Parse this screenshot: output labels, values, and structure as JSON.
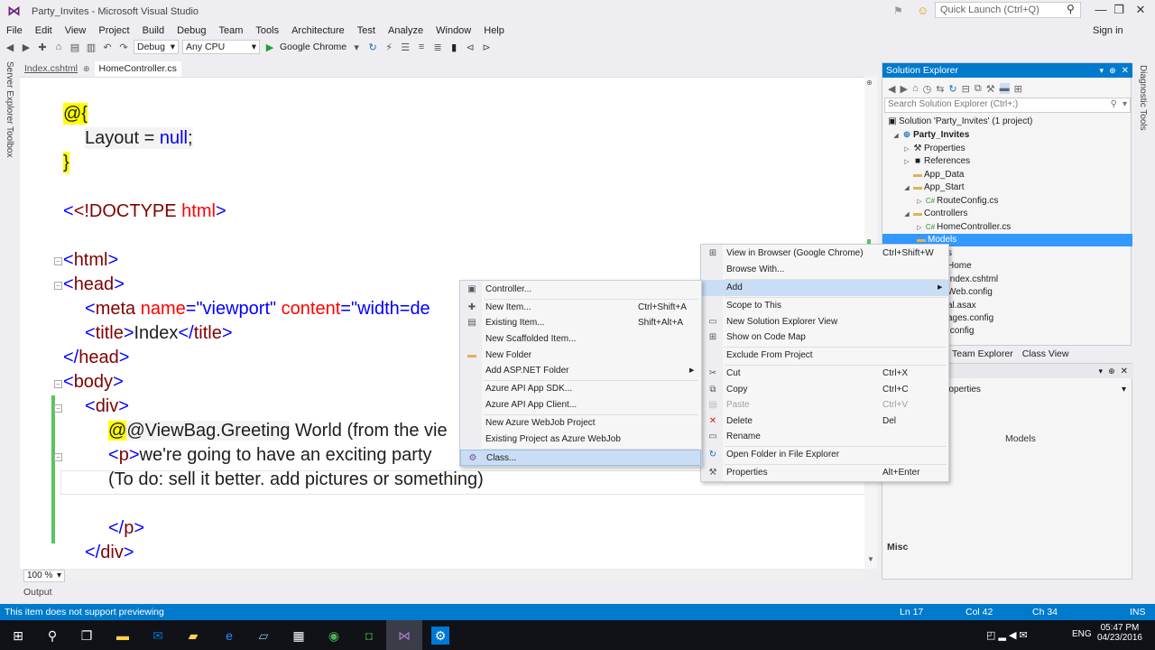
{
  "window": {
    "title": "Party_Invites - Microsoft Visual Studio",
    "quick_launch_placeholder": "Quick Launch (Ctrl+Q)",
    "sign_in": "Sign in"
  },
  "menu": [
    "File",
    "Edit",
    "View",
    "Project",
    "Build",
    "Debug",
    "Team",
    "Tools",
    "Architecture",
    "Test",
    "Analyze",
    "Window",
    "Help"
  ],
  "toolbar": {
    "config": "Debug",
    "platform": "Any CPU",
    "browser": "Google Chrome"
  },
  "left_tabs": [
    "Server Explorer",
    "Toolbox"
  ],
  "doc_tabs": [
    {
      "label": "Index.cshtml",
      "active": false
    },
    {
      "label": "HomeController.cs",
      "active": true
    }
  ],
  "editor": {
    "zoom": "100 %",
    "lines": {
      "l1": "@{",
      "l2a": "Layout = ",
      "l2b": "null",
      "l2c": ";",
      "l3": "}",
      "l4a": "<!DOCTYPE",
      "l4b": "html",
      "l4c": ">",
      "l5": "html",
      "l6": "head",
      "l7a": "meta",
      "l7b": "name",
      "l7c": "\"viewport\"",
      "l7d": "content",
      "l7e": "\"width=de",
      "l8a": "title",
      "l8b": "Index",
      "l9": "head",
      "l10": "body",
      "l11": "div",
      "l12a": "@ViewBag.Greeting",
      "l12b": " World (from the vie",
      "l13a": "p",
      "l13b": "we're going to have an exciting party",
      "l14": "(To do: sell it better. add pictures or something)",
      "l15": "p",
      "l16": "div"
    }
  },
  "output_tab": "Output",
  "status": {
    "message": "This item does not support previewing",
    "ln": "Ln 17",
    "col": "Col 42",
    "ch": "Ch 34",
    "mode": "INS"
  },
  "solution_explorer": {
    "title": "Solution Explorer",
    "search_placeholder": "Search Solution Explorer (Ctrl+;)",
    "items": [
      {
        "label": "Solution 'Party_Invites' (1 project)",
        "indent": 0
      },
      {
        "label": "Party_Invites",
        "indent": 1,
        "bold": true
      },
      {
        "label": "Properties",
        "indent": 2
      },
      {
        "label": "References",
        "indent": 2
      },
      {
        "label": "App_Data",
        "indent": 2
      },
      {
        "label": "App_Start",
        "indent": 2
      },
      {
        "label": "RouteConfig.cs",
        "indent": 3
      },
      {
        "label": "Controllers",
        "indent": 2
      },
      {
        "label": "HomeController.cs",
        "indent": 3
      },
      {
        "label": "Models",
        "indent": 2,
        "selected": true
      },
      {
        "label": "s",
        "indent": 2
      },
      {
        "label": "Home",
        "indent": 2
      },
      {
        "label": "Index.cshtml",
        "indent": 3
      },
      {
        "label": "Web.config",
        "indent": 2
      },
      {
        "label": "al.asax",
        "indent": 2
      },
      {
        "label": "ages.config",
        "indent": 2
      },
      {
        "label": ".config",
        "indent": 2
      }
    ],
    "bottom_tabs": [
      "Team Explorer",
      "Class View"
    ]
  },
  "properties": {
    "combo": "roperties",
    "object": "Models",
    "category": "Misc"
  },
  "diagnostic_tab": "Diagnostic Tools",
  "context_menu_main": [
    {
      "label": "View in Browser (Google Chrome)",
      "shortcut": "Ctrl+Shift+W",
      "icon": "browser-icon"
    },
    {
      "label": "Browse With...",
      "shortcut": "",
      "icon": ""
    },
    {
      "label": "Add",
      "shortcut": "",
      "icon": "",
      "submenu": true,
      "highlighted": true
    },
    {
      "label": "Scope to This",
      "shortcut": "",
      "icon": ""
    },
    {
      "label": "New Solution Explorer View",
      "shortcut": "",
      "icon": "window-icon"
    },
    {
      "label": "Show on Code Map",
      "shortcut": "",
      "icon": "codemap-icon"
    },
    {
      "label": "Exclude From Project",
      "shortcut": "",
      "icon": ""
    },
    {
      "label": "Cut",
      "shortcut": "Ctrl+X",
      "icon": "scissors-icon"
    },
    {
      "label": "Copy",
      "shortcut": "Ctrl+C",
      "icon": "copy-icon"
    },
    {
      "label": "Paste",
      "shortcut": "Ctrl+V",
      "icon": "paste-icon",
      "disabled": true
    },
    {
      "label": "Delete",
      "shortcut": "Del",
      "icon": "delete-icon"
    },
    {
      "label": "Rename",
      "shortcut": "",
      "icon": "rename-icon"
    },
    {
      "label": "Open Folder in File Explorer",
      "shortcut": "",
      "icon": "refresh-folder-icon"
    },
    {
      "label": "Properties",
      "shortcut": "Alt+Enter",
      "icon": "wrench-icon"
    }
  ],
  "context_menu_add": [
    {
      "label": "Controller...",
      "shortcut": "",
      "icon": "controller-icon"
    },
    {
      "label": "New Item...",
      "shortcut": "Ctrl+Shift+A",
      "icon": "new-item-icon"
    },
    {
      "label": "Existing Item...",
      "shortcut": "Shift+Alt+A",
      "icon": "existing-item-icon"
    },
    {
      "label": "New Scaffolded Item...",
      "shortcut": "",
      "icon": ""
    },
    {
      "label": "New Folder",
      "shortcut": "",
      "icon": "folder-icon"
    },
    {
      "label": "Add ASP.NET Folder",
      "shortcut": "",
      "icon": "",
      "submenu": true
    },
    {
      "label": "Azure API App SDK...",
      "shortcut": "",
      "icon": ""
    },
    {
      "label": "Azure API App Client...",
      "shortcut": "",
      "icon": ""
    },
    {
      "label": "New Azure WebJob Project",
      "shortcut": "",
      "icon": ""
    },
    {
      "label": "Existing Project as Azure WebJob",
      "shortcut": "",
      "icon": ""
    },
    {
      "label": "Class...",
      "shortcut": "",
      "icon": "class-icon",
      "highlighted": true
    }
  ],
  "taskbar": {
    "time": "05:47 PM",
    "date": "04/23/2016",
    "lang": "ENG"
  },
  "colors": {
    "accent": "#007acc",
    "selection": "#3399ff",
    "menu_highlight": "#c9def5",
    "change_bar": "#57c55c"
  }
}
